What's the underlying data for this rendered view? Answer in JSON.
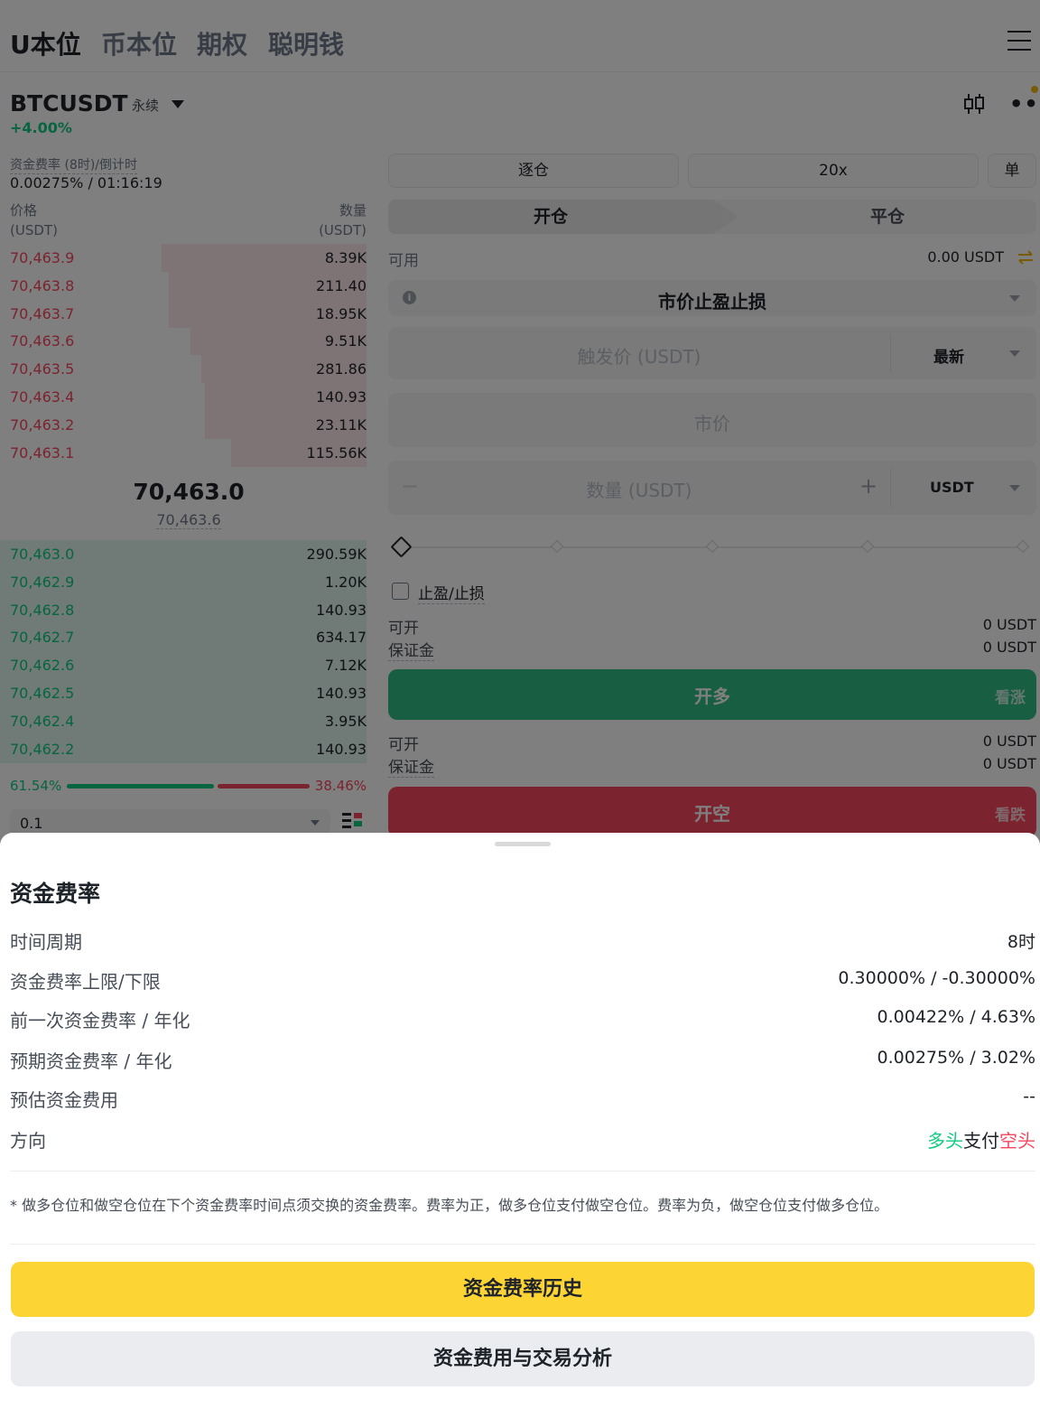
{
  "top_tabs": [
    "U本位",
    "币本位",
    "期权",
    "聪明钱"
  ],
  "header": {
    "symbol": "BTCUSDT",
    "contract_type": "永续",
    "change": "+4.00%"
  },
  "funding": {
    "label": "资金费率 (8时)/倒计时",
    "value": "0.00275% / 01:16:19"
  },
  "orderbook": {
    "price_header": "价格",
    "price_unit": "(USDT)",
    "qty_header": "数量",
    "qty_unit": "(USDT)",
    "asks": [
      {
        "price": "70,463.9",
        "qty": "8.39K",
        "depth": 0.56
      },
      {
        "price": "70,463.8",
        "qty": "211.40",
        "depth": 0.54
      },
      {
        "price": "70,463.7",
        "qty": "18.95K",
        "depth": 0.54
      },
      {
        "price": "70,463.6",
        "qty": "9.51K",
        "depth": 0.48
      },
      {
        "price": "70,463.5",
        "qty": "281.86",
        "depth": 0.45
      },
      {
        "price": "70,463.4",
        "qty": "140.93",
        "depth": 0.44
      },
      {
        "price": "70,463.2",
        "qty": "23.11K",
        "depth": 0.44
      },
      {
        "price": "70,463.1",
        "qty": "115.56K",
        "depth": 0.37
      }
    ],
    "last_price": "70,463.0",
    "mark_price": "70,463.6",
    "bids": [
      {
        "price": "70,463.0",
        "qty": "290.59K",
        "depth": 1.0
      },
      {
        "price": "70,462.9",
        "qty": "1.20K",
        "depth": 1.0
      },
      {
        "price": "70,462.8",
        "qty": "140.93",
        "depth": 1.0
      },
      {
        "price": "70,462.7",
        "qty": "634.17",
        "depth": 1.0
      },
      {
        "price": "70,462.6",
        "qty": "7.12K",
        "depth": 1.0
      },
      {
        "price": "70,462.5",
        "qty": "140.93",
        "depth": 1.0
      },
      {
        "price": "70,462.4",
        "qty": "3.95K",
        "depth": 1.0
      },
      {
        "price": "70,462.2",
        "qty": "140.93",
        "depth": 1.0
      }
    ],
    "buy_ratio": "61.54%",
    "sell_ratio": "38.46%",
    "precision": "0.1"
  },
  "form": {
    "margin_mode": "逐仓",
    "leverage": "20x",
    "position_mode": "单",
    "open_tab": "开仓",
    "close_tab": "平仓",
    "available_label": "可用",
    "available_value": "0.00 USDT",
    "order_type": "市价止盈止损",
    "trigger_placeholder": "触发价 (USDT)",
    "trigger_source": "最新",
    "market_label": "市价",
    "quantity_placeholder": "数量 (USDT)",
    "quantity_minus": "−",
    "quantity_plus": "+",
    "quantity_unit": "USDT",
    "tpsl_label": "止盈/止损",
    "long_summary": {
      "max_label": "可开",
      "max_value": "0 USDT",
      "margin_label": "保证金",
      "margin_value": "0 USDT"
    },
    "long_button": "开多",
    "long_sub": "看涨",
    "short_summary": {
      "max_label": "可开",
      "max_value": "0 USDT",
      "margin_label": "保证金",
      "margin_value": "0 USDT"
    },
    "short_button": "开空",
    "short_sub": "看跌"
  },
  "sheet": {
    "title": "资金费率",
    "rows": [
      {
        "label": "时间周期",
        "value": "8时"
      },
      {
        "label": "资金费率上限/下限",
        "value": "0.30000% / -0.30000%"
      },
      {
        "label": "前一次资金费率 / 年化",
        "value": "0.00422% / 4.63%"
      },
      {
        "label": "预期资金费率 / 年化",
        "value": "0.00275% / 3.02%"
      },
      {
        "label": "预估资金费用",
        "value": "--"
      }
    ],
    "direction": {
      "label": "方向",
      "long_word": "多头",
      "pays": "支付",
      "short_word": "空头"
    },
    "note": "* 做多仓位和做空仓位在下个资金费率时间点须交换的资金费率。费率为正，做多仓位支付做空仓位。费率为负，做空仓位支付做多仓位。",
    "history_button": "资金费率历史",
    "analysis_button": "资金费用与交易分析"
  },
  "colors": {
    "buy": "#0ecb81",
    "sell": "#f6465d",
    "brand": "#fcd535"
  }
}
